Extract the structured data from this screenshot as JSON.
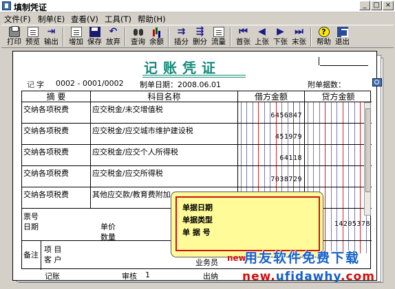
{
  "window": {
    "title": "填制凭证",
    "minimize": "_",
    "maximize": "□",
    "close": "×"
  },
  "menu": [
    "文件(F)",
    "制单(E)",
    "查看(V)",
    "工具(T)",
    "帮助(H)"
  ],
  "toolbar": {
    "print": "打印",
    "preview": "预览",
    "export": "输出",
    "add": "增加",
    "save": "保存",
    "abandon": "放弃",
    "query": "查询",
    "balance": "余额",
    "insert": "插分",
    "delete": "删分",
    "flow": "流量",
    "first": "首张",
    "prev": "上张",
    "next": "下张",
    "last": "末张",
    "help": "帮助",
    "exit": "退出"
  },
  "voucher": {
    "title": "记账凭证",
    "ji_label": "记",
    "zi_label": "字",
    "number": "0002 - 0001/0002",
    "date_label": "制单日期：2008.06.01",
    "attach_label": "附单据数：",
    "col_summary": "摘 要",
    "col_account": "科目名称",
    "col_debit": "借方金额",
    "col_credit": "贷方金额",
    "rows": [
      {
        "summary": "交纳各项税费",
        "account": "应交税金/未交增值税",
        "debit": "6456847"
      },
      {
        "summary": "交纳各项税费",
        "account": "应交税金/应交城市维护建设税",
        "debit": "451979"
      },
      {
        "summary": "交纳各项税费",
        "account": "应交税金/应交个人所得税",
        "debit": "64118"
      },
      {
        "summary": "交纳各项税费",
        "account": "应交税金/应交所得税",
        "debit": "7038729"
      },
      {
        "summary": "交纳各项税费",
        "account": "其他应交款/教育费附加",
        "debit": ""
      }
    ],
    "total_credit": "14205378",
    "piaohao": "票号",
    "riqi": "日期",
    "danjia": "单价",
    "shuliang": "数量",
    "beizhu": "备注",
    "xiangmu": "项  目",
    "kehu": "客  户",
    "yewuyuan": "业务员",
    "jizhang": "记账",
    "shenhe": "审核",
    "shenhe_val": "1",
    "chuna": "出纳"
  },
  "popup": {
    "date": "单据日期",
    "type": "单据类型",
    "number": "单 据 号"
  },
  "watermark": {
    "brand": "用友软件免费下载",
    "prefix": "new",
    "url_red": "new.",
    "url_blue": "ufidawhy",
    "url_end": ".com"
  }
}
